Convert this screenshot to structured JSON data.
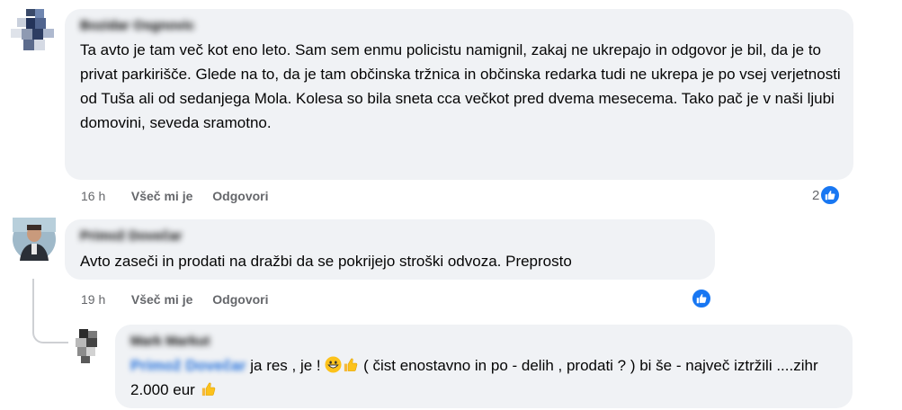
{
  "comments": [
    {
      "author": "Bozidar Osgnovic",
      "text": "Ta avto je tam več kot eno leto. Sam sem enmu policistu namignil, zakaj ne ukrepajo in odgovor je bil, da je to privat parkirišče. Glede na to, da je tam občinska tržnica in občinska redarka tudi ne ukrepa je po vsej verjetnosti od Tuša ali od sedanjega Mola. Kolesa so bila sneta cca večkot pred dvema mesecema. Tako pač je v naši ljubi domovini, seveda sramotno.",
      "time": "16 h",
      "like_label": "Všeč mi je",
      "reply_label": "Odgovori",
      "reaction_count": "2"
    },
    {
      "author": "Primož Dovečar",
      "text": "Avto zaseči in prodati na dražbi da se pokrijejo stroški odvoza. Preprosto",
      "time": "19 h",
      "like_label": "Všeč mi je",
      "reply_label": "Odgovori",
      "reaction_count": ""
    }
  ],
  "reply": {
    "author": "Mark Markut",
    "tag": "Primož Dovečar",
    "text_part1": "ja res , je !",
    "text_part2": "( čist enostavno in po - delih , prodati ? ) bi še - največ iztržili ....zihr 2.000 eur"
  },
  "icons": {
    "like": "like-thumb-icon",
    "grin": "grinning-emoji-icon",
    "thumbs": "thumbs-up-emoji-icon"
  },
  "colors": {
    "like_blue": "#1877f2",
    "bubble_bg": "#f0f2f5",
    "meta_gray": "#65676b"
  }
}
